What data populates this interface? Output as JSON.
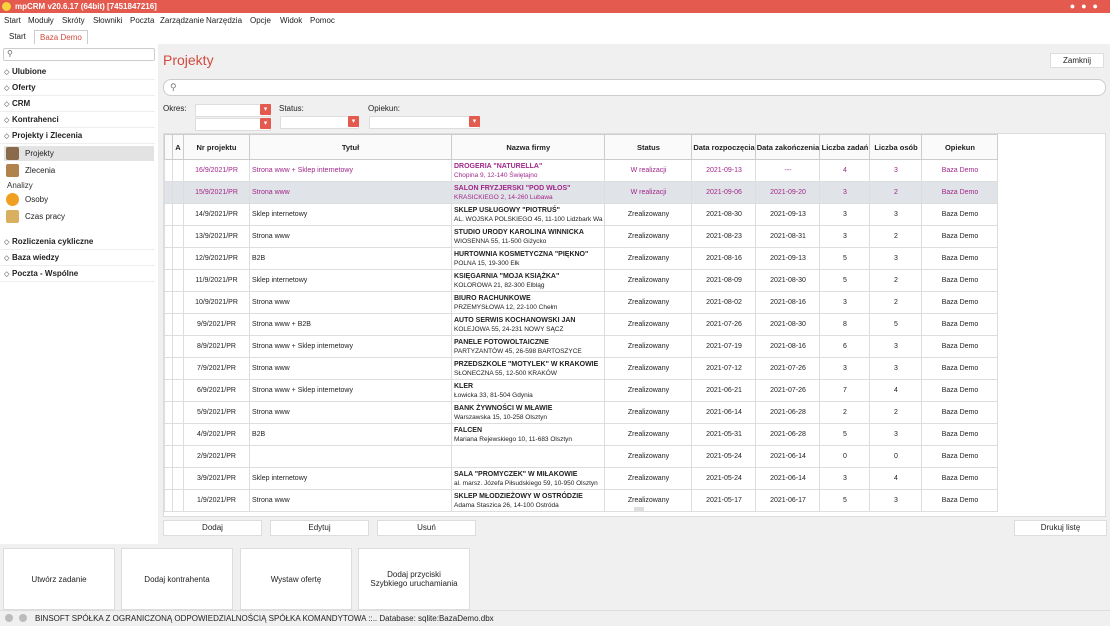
{
  "window": {
    "title": "mpCRM v20.6.17 (64bit) [7451847216]"
  },
  "menu": [
    "Start",
    "Moduły",
    "Skróty",
    "Słowniki",
    "Poczta",
    "Zarządzanie",
    "Narzędzia",
    "Opcje",
    "Widok",
    "Pomoc"
  ],
  "tabs": [
    {
      "label": "Start"
    },
    {
      "label": "Baza Demo"
    }
  ],
  "sidebar": {
    "sections_top": [
      "Ulubione",
      "Oferty",
      "CRM",
      "Kontrahenci",
      "Projekty i Zlecenia"
    ],
    "items": [
      "Projekty",
      "Zlecenia"
    ],
    "analizy_label": "Analizy",
    "analizy_items": [
      "Osoby",
      "Czas pracy"
    ],
    "sections_bottom": [
      "Rozliczenia cykliczne",
      "Baza wiedzy",
      "Poczta - Wspólne"
    ]
  },
  "page": {
    "title": "Projekty",
    "close_label": "Zamknij",
    "filters": {
      "okres": "Okres:",
      "status": "Status:",
      "opiekun": "Opiekun:"
    }
  },
  "grid": {
    "columns": [
      "A",
      "Nr projektu",
      "Tytuł",
      "Nazwa firmy",
      "Status",
      "Data rozpoczęcia",
      "Data zakończenia",
      "Liczba zadań",
      "Liczba osób",
      "Opiekun"
    ],
    "rows": [
      {
        "nr": "16/9/2021/PR",
        "tytul": "Strona www + Sklep internetowy",
        "firma": "DROGERIA \"NATURELLA\"",
        "adres": "Chopina 9, 12-140 Świętajno",
        "status": "W realizacji",
        "start": "2021-09-13",
        "end": "---",
        "zad": "4",
        "os": "3",
        "opiekun": "Baza Demo"
      },
      {
        "nr": "15/9/2021/PR",
        "tytul": "Strona www",
        "firma": "SALON FRYZJERSKI \"POD WŁOS\"",
        "adres": "KRASICKIEGO 2, 14-260 Lubawa",
        "status": "W realizacji",
        "start": "2021-09-06",
        "end": "2021-09-20",
        "zad": "3",
        "os": "2",
        "opiekun": "Baza Demo"
      },
      {
        "nr": "14/9/2021/PR",
        "tytul": "Sklep internetowy",
        "firma": "SKLEP USŁUGOWY \"PIOTRUŚ\"",
        "adres": "AL. WOJSKA POLSKIEGO 45, 11-100 Lidzbark Wa",
        "status": "Zrealizowany",
        "start": "2021-08-30",
        "end": "2021-09-13",
        "zad": "3",
        "os": "3",
        "opiekun": "Baza Demo"
      },
      {
        "nr": "13/9/2021/PR",
        "tytul": "Strona www",
        "firma": "STUDIO URODY KAROLINA WINNICKA",
        "adres": "WIOSENNA 55, 11-500 Giżycko",
        "status": "Zrealizowany",
        "start": "2021-08-23",
        "end": "2021-08-31",
        "zad": "3",
        "os": "2",
        "opiekun": "Baza Demo"
      },
      {
        "nr": "12/9/2021/PR",
        "tytul": "B2B",
        "firma": "HURTOWNIA KOSMETYCZNA \"PIĘKNO\"",
        "adres": "POLNA 15, 19-300 Ełk",
        "status": "Zrealizowany",
        "start": "2021-08-16",
        "end": "2021-09-13",
        "zad": "5",
        "os": "3",
        "opiekun": "Baza Demo"
      },
      {
        "nr": "11/9/2021/PR",
        "tytul": "Sklep internetowy",
        "firma": "KSIĘGARNIA \"MOJA KSIĄŻKA\"",
        "adres": "KOLOROWA 21, 82-300 Elbląg",
        "status": "Zrealizowany",
        "start": "2021-08-09",
        "end": "2021-08-30",
        "zad": "5",
        "os": "2",
        "opiekun": "Baza Demo"
      },
      {
        "nr": "10/9/2021/PR",
        "tytul": "Strona www",
        "firma": "BIURO RACHUNKOWE",
        "adres": "PRZEMYSŁOWA 12, 22-100 Chełm",
        "status": "Zrealizowany",
        "start": "2021-08-02",
        "end": "2021-08-16",
        "zad": "3",
        "os": "2",
        "opiekun": "Baza Demo"
      },
      {
        "nr": "9/9/2021/PR",
        "tytul": "Strona www + B2B",
        "firma": "AUTO SERWIS KOCHANOWSKI JAN",
        "adres": "KOLEJOWA 55, 24-231 NOWY SĄCZ",
        "status": "Zrealizowany",
        "start": "2021-07-26",
        "end": "2021-08-30",
        "zad": "8",
        "os": "5",
        "opiekun": "Baza Demo"
      },
      {
        "nr": "8/9/2021/PR",
        "tytul": "Strona www + Sklep internetowy",
        "firma": "PANELE FOTOWOLTAICZNE",
        "adres": "PARTYZANTÓW 45, 26-598 BARTOSZYCE",
        "status": "Zrealizowany",
        "start": "2021-07-19",
        "end": "2021-08-16",
        "zad": "6",
        "os": "3",
        "opiekun": "Baza Demo"
      },
      {
        "nr": "7/9/2021/PR",
        "tytul": "Strona www",
        "firma": "PRZEDSZKOLE \"MOTYLEK\" W KRAKOWIE",
        "adres": "SŁONECZNA 55, 12-500 KRAKÓW",
        "status": "Zrealizowany",
        "start": "2021-07-12",
        "end": "2021-07-26",
        "zad": "3",
        "os": "3",
        "opiekun": "Baza Demo"
      },
      {
        "nr": "6/9/2021/PR",
        "tytul": "Strona www + Sklep internetowy",
        "firma": "KLER",
        "adres": "Łowicka 33, 81-504 Gdynia",
        "status": "Zrealizowany",
        "start": "2021-06-21",
        "end": "2021-07-26",
        "zad": "7",
        "os": "4",
        "opiekun": "Baza Demo"
      },
      {
        "nr": "5/9/2021/PR",
        "tytul": "Strona www",
        "firma": "BANK ŻYWNOŚCI W MŁAWIE",
        "adres": "Warszawska 15, 10-258 Olsztyn",
        "status": "Zrealizowany",
        "start": "2021-06-14",
        "end": "2021-06-28",
        "zad": "2",
        "os": "2",
        "opiekun": "Baza Demo"
      },
      {
        "nr": "4/9/2021/PR",
        "tytul": "B2B",
        "firma": "FALCEN",
        "adres": "Mariana Rejewskiego 10, 11-683 Olsztyn",
        "status": "Zrealizowany",
        "start": "2021-05-31",
        "end": "2021-06-28",
        "zad": "5",
        "os": "3",
        "opiekun": "Baza Demo"
      },
      {
        "nr": "2/9/2021/PR",
        "tytul": "",
        "firma": "",
        "adres": "",
        "status": "Zrealizowany",
        "start": "2021-05-24",
        "end": "2021-06-14",
        "zad": "0",
        "os": "0",
        "opiekun": "Baza Demo"
      },
      {
        "nr": "3/9/2021/PR",
        "tytul": "Sklep internetowy",
        "firma": "SALA \"PROMYCZEK\" W MIŁAKOWIE",
        "adres": "al. marsz. Józefa Piłsudskiego 59, 10-950 Olsztyn",
        "status": "Zrealizowany",
        "start": "2021-05-24",
        "end": "2021-06-14",
        "zad": "3",
        "os": "4",
        "opiekun": "Baza Demo"
      },
      {
        "nr": "1/9/2021/PR",
        "tytul": "Strona www",
        "firma": "SKLEP MŁODZIEŻOWY W OSTRÓDZIE",
        "adres": "Adama Staszica 26, 14-100 Ostróda",
        "status": "Zrealizowany",
        "start": "2021-05-17",
        "end": "2021-06-17",
        "zad": "5",
        "os": "3",
        "opiekun": "Baza Demo"
      }
    ]
  },
  "actions": {
    "dodaj": "Dodaj",
    "edytuj": "Edytuj",
    "usun": "Usuń",
    "drukuj": "Drukuj listę"
  },
  "quick": [
    "Utwórz zadanie",
    "Dodaj kontrahenta",
    "Wystaw ofertę",
    "Dodaj przyciski\nSzybkiego uruchamiania"
  ],
  "status": {
    "text": "BINSOFT SPÓŁKA Z OGRANICZONĄ ODPOWIEDZIALNOŚCIĄ SPÓŁKA KOMANDYTOWA ::.. Database: sqlite:BazaDemo.dbx"
  },
  "colors": {
    "accent": "#e45a4f",
    "highlight_text": "#a0278a"
  }
}
